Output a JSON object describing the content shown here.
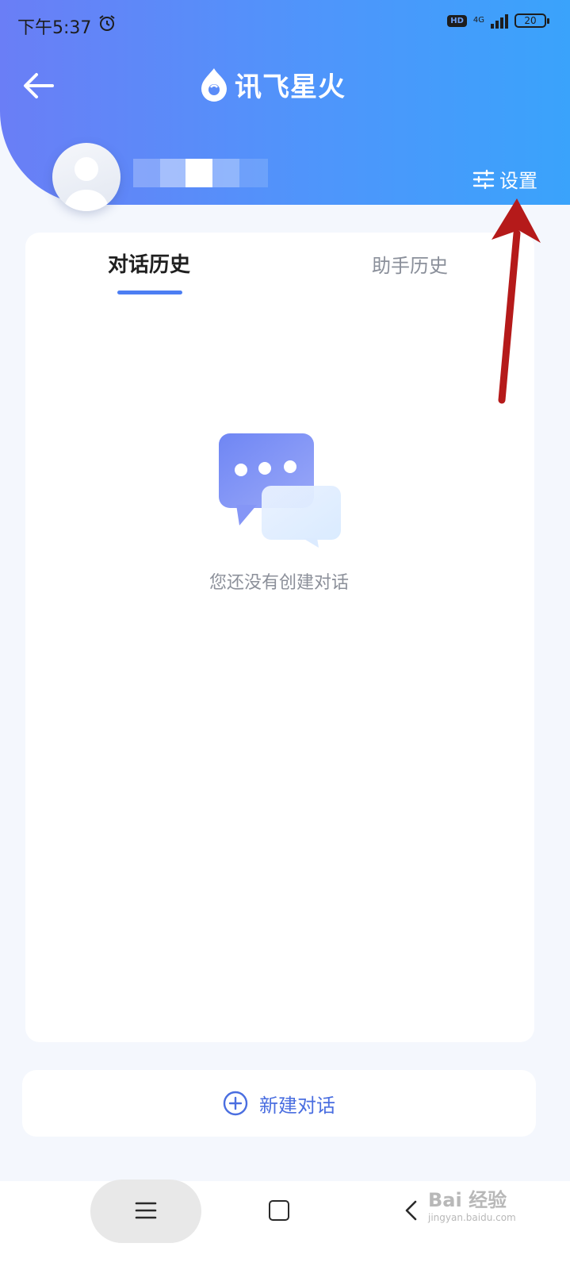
{
  "status_bar": {
    "time": "下午5:37",
    "hd": "HD",
    "network": "4G",
    "battery": "20"
  },
  "header": {
    "app_name": "讯飞星火",
    "settings_label": "设置"
  },
  "tabs": [
    {
      "label": "对话历史",
      "active": true
    },
    {
      "label": "助手历史",
      "active": false
    }
  ],
  "empty_state": {
    "message": "您还没有创建对话"
  },
  "new_chat": {
    "label": "新建对话"
  },
  "watermark": {
    "brand": "Bai 经验",
    "sub": "jingyan.baidu.com"
  },
  "colors": {
    "accent": "#4c7ef3",
    "header_start": "#6a7ef6",
    "header_end": "#3aa3fb",
    "arrow": "#b51a1a"
  }
}
